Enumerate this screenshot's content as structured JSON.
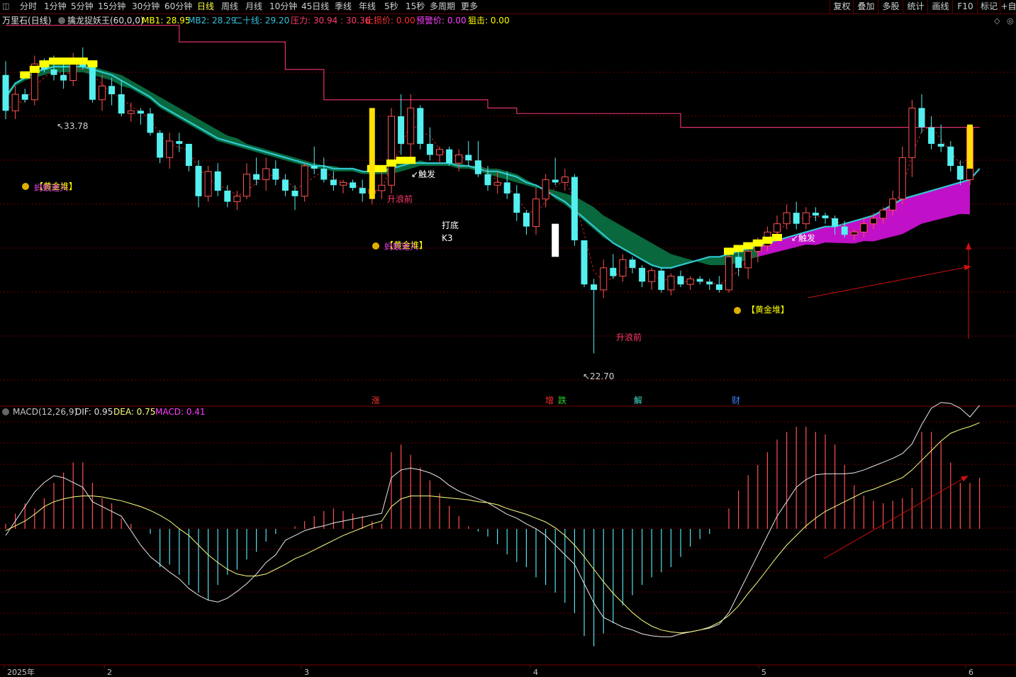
{
  "toolbar": {
    "left_items": [
      "分时",
      "1分钟",
      "5分钟",
      "15分钟",
      "30分钟",
      "60分钟",
      "日线",
      "周线",
      "月线",
      "10分钟",
      "45日线",
      "季线",
      "年线",
      "5秒",
      "15秒",
      "多周期",
      "更多"
    ],
    "active": "日线",
    "right_items": [
      "复权",
      "叠加",
      "多股",
      "统计",
      "画线",
      "F10",
      "标记",
      "+自"
    ]
  },
  "main_legend": {
    "stock": "万里石(日线)",
    "indicator": "擒龙捉妖王(60,0,0)",
    "items": [
      {
        "label": "MB1: 28.95",
        "color": "#ffff00"
      },
      {
        "label": "MB2: 28.29",
        "color": "#36c0d8"
      },
      {
        "label": "二十线: 29.20",
        "color": "#36c0d8"
      },
      {
        "label": "压力: 30.94",
        "color": "#ff3a6a"
      },
      {
        "label": ": 30.36",
        "color": "#ff3a6a"
      },
      {
        "label": "止损价: 0.00",
        "color": "#ff3030"
      },
      {
        "label": "预警价: 0.00",
        "color": "#ff40ff"
      },
      {
        "label": "狙击: 0.00",
        "color": "#ffff00"
      }
    ]
  },
  "macd_legend": {
    "items": [
      {
        "label": "MACD(12,26,9)",
        "color": "#c8c8c8"
      },
      {
        "label": "DIF: 0.95",
        "color": "#e0e0e0"
      },
      {
        "label": "DEA: 0.75",
        "color": "#ffff80"
      },
      {
        "label": "MACD: 0.41",
        "color": "#ff40ff"
      }
    ]
  },
  "annotations": {
    "high_label": "33.78",
    "low_label": "22.70",
    "gold_label": "【黄金堆】",
    "ant_label": "蚂蚁进入",
    "trigger_label": "触发",
    "wave_before": "升浪前",
    "bottom_label": "打底",
    "k3_label": "K3",
    "events": [
      {
        "text": "涨",
        "color": "#ff3030"
      },
      {
        "text": "增",
        "color": "#ff3030"
      },
      {
        "text": "跌",
        "color": "#30d030"
      },
      {
        "text": "解",
        "color": "#40e0d0"
      },
      {
        "text": "财",
        "color": "#4080ff"
      }
    ],
    "date_labels": [
      "2025年",
      "2",
      "3",
      "4",
      "5",
      "6"
    ]
  },
  "chart_data": {
    "type": "candlestick",
    "title": "万里石(日线)",
    "ylim": [
      21.5,
      34.8
    ],
    "ohlc": [
      [
        32.8,
        33.3,
        31.2,
        31.5
      ],
      [
        31.5,
        32.4,
        31.2,
        32.1
      ],
      [
        32.1,
        32.3,
        31.8,
        31.9
      ],
      [
        31.9,
        33.5,
        31.7,
        33.2
      ],
      [
        33.2,
        33.4,
        32.9,
        33.0
      ],
      [
        33.0,
        33.5,
        32.6,
        32.8
      ],
      [
        32.8,
        33.3,
        32.3,
        32.6
      ],
      [
        32.6,
        33.6,
        32.4,
        33.4
      ],
      [
        33.4,
        33.8,
        33.0,
        33.1
      ],
      [
        33.1,
        33.3,
        31.8,
        31.9
      ],
      [
        31.9,
        32.8,
        31.5,
        32.4
      ],
      [
        32.4,
        32.7,
        31.7,
        32.1
      ],
      [
        32.1,
        32.6,
        31.3,
        31.4
      ],
      [
        31.4,
        31.8,
        31.1,
        31.5
      ],
      [
        31.5,
        31.6,
        31.0,
        31.4
      ],
      [
        31.4,
        31.6,
        30.6,
        30.7
      ],
      [
        30.7,
        30.8,
        29.6,
        29.8
      ],
      [
        29.8,
        30.7,
        29.4,
        30.4
      ],
      [
        30.4,
        30.7,
        30.0,
        30.3
      ],
      [
        30.3,
        30.3,
        29.3,
        29.5
      ],
      [
        29.5,
        29.7,
        28.0,
        28.4
      ],
      [
        28.4,
        29.5,
        28.2,
        29.3
      ],
      [
        29.3,
        29.6,
        28.4,
        28.6
      ],
      [
        28.6,
        28.8,
        28.0,
        28.2
      ],
      [
        28.2,
        28.6,
        27.9,
        28.4
      ],
      [
        28.4,
        29.6,
        28.3,
        29.2
      ],
      [
        29.2,
        29.8,
        28.8,
        29.0
      ],
      [
        29.0,
        29.8,
        28.6,
        29.4
      ],
      [
        29.4,
        29.7,
        28.8,
        29.0
      ],
      [
        29.0,
        29.2,
        28.4,
        28.6
      ],
      [
        28.6,
        28.8,
        27.9,
        28.4
      ],
      [
        28.4,
        29.6,
        28.2,
        29.5
      ],
      [
        29.5,
        30.2,
        29.2,
        29.4
      ],
      [
        29.4,
        29.8,
        28.9,
        29.0
      ],
      [
        29.0,
        29.3,
        28.6,
        28.8
      ],
      [
        28.8,
        29.0,
        28.5,
        28.9
      ],
      [
        28.9,
        29.0,
        28.6,
        28.7
      ],
      [
        28.7,
        29.0,
        28.2,
        28.5
      ],
      [
        28.5,
        28.8,
        28.1,
        28.6
      ],
      [
        28.6,
        29.4,
        28.3,
        28.8
      ],
      [
        28.8,
        31.6,
        28.5,
        31.3
      ],
      [
        31.3,
        32.1,
        29.9,
        30.3
      ],
      [
        30.3,
        32.1,
        29.8,
        31.6
      ],
      [
        31.6,
        31.7,
        30.1,
        30.3
      ],
      [
        30.3,
        30.9,
        29.7,
        29.9
      ],
      [
        29.9,
        30.2,
        29.6,
        30.1
      ],
      [
        30.1,
        30.2,
        29.5,
        29.6
      ],
      [
        29.6,
        30.1,
        29.3,
        29.9
      ],
      [
        29.9,
        30.4,
        29.5,
        29.7
      ],
      [
        29.7,
        30.4,
        29.1,
        29.2
      ],
      [
        29.2,
        29.5,
        28.6,
        28.8
      ],
      [
        28.8,
        29.3,
        28.5,
        28.9
      ],
      [
        28.9,
        29.3,
        28.3,
        28.5
      ],
      [
        28.5,
        28.8,
        27.5,
        27.8
      ],
      [
        27.8,
        27.9,
        27.0,
        27.3
      ],
      [
        27.3,
        28.7,
        27.0,
        28.3
      ],
      [
        28.3,
        29.2,
        28.0,
        29.0
      ],
      [
        29.0,
        29.8,
        28.8,
        28.9
      ],
      [
        28.9,
        29.4,
        28.6,
        29.1
      ],
      [
        29.1,
        29.2,
        26.6,
        26.8
      ],
      [
        26.8,
        26.8,
        25.1,
        25.2
      ],
      [
        25.2,
        25.4,
        22.7,
        25.0
      ],
      [
        25.0,
        26.1,
        24.7,
        25.8
      ],
      [
        25.8,
        26.3,
        25.4,
        25.5
      ],
      [
        25.5,
        26.3,
        25.3,
        26.1
      ],
      [
        26.1,
        26.2,
        25.6,
        25.8
      ],
      [
        25.8,
        25.9,
        25.1,
        25.3
      ],
      [
        25.3,
        25.8,
        25.0,
        25.7
      ],
      [
        25.7,
        25.8,
        24.9,
        25.0
      ],
      [
        25.0,
        25.6,
        24.8,
        25.5
      ],
      [
        25.5,
        25.7,
        25.1,
        25.2
      ],
      [
        25.2,
        25.5,
        25.0,
        25.4
      ],
      [
        25.4,
        25.5,
        25.2,
        25.3
      ],
      [
        25.3,
        25.4,
        25.0,
        25.2
      ],
      [
        25.2,
        25.5,
        24.9,
        25.0
      ],
      [
        25.0,
        26.4,
        24.9,
        26.2
      ],
      [
        26.2,
        26.4,
        25.5,
        25.8
      ],
      [
        25.8,
        26.6,
        25.4,
        26.4
      ],
      [
        26.4,
        26.9,
        26.0,
        26.6
      ],
      [
        26.6,
        27.3,
        26.4,
        27.1
      ],
      [
        27.1,
        27.7,
        26.8,
        27.4
      ],
      [
        27.4,
        28.1,
        27.2,
        27.8
      ],
      [
        27.8,
        28.2,
        27.2,
        27.4
      ],
      [
        27.4,
        28.0,
        27.2,
        27.8
      ],
      [
        27.8,
        28.0,
        27.5,
        27.7
      ],
      [
        27.7,
        27.8,
        27.4,
        27.6
      ],
      [
        27.6,
        27.7,
        27.0,
        27.3
      ],
      [
        27.3,
        27.5,
        26.9,
        27.0
      ],
      [
        27.0,
        27.2,
        26.8,
        27.1
      ],
      [
        27.1,
        27.6,
        26.9,
        27.4
      ],
      [
        27.4,
        27.8,
        27.2,
        27.6
      ],
      [
        27.6,
        28.0,
        27.4,
        27.9
      ],
      [
        27.9,
        28.6,
        27.7,
        28.3
      ],
      [
        28.3,
        30.2,
        28.1,
        29.8
      ],
      [
        29.8,
        31.9,
        29.1,
        31.6
      ],
      [
        31.6,
        32.1,
        30.7,
        30.9
      ],
      [
        30.9,
        31.3,
        30.1,
        30.3
      ],
      [
        30.3,
        31.0,
        30.0,
        30.2
      ],
      [
        30.2,
        30.4,
        29.3,
        29.5
      ],
      [
        29.5,
        29.7,
        28.8,
        29.0
      ],
      [
        29.0,
        31.0,
        28.8,
        30.9
      ]
    ],
    "ma_slow": [
      31.9,
      32.4,
      32.6,
      32.7,
      32.8,
      32.9,
      32.9,
      32.9,
      32.9,
      32.8,
      32.7,
      32.6,
      32.4,
      32.3,
      32.1,
      31.9,
      31.6,
      31.4,
      31.2,
      31.0,
      30.8,
      30.6,
      30.4,
      30.3,
      30.2,
      30.1,
      30.0,
      29.9,
      29.8,
      29.7,
      29.6,
      29.5,
      29.4,
      29.4,
      29.3,
      29.3,
      29.3,
      29.2,
      29.2,
      29.2,
      29.2,
      29.3,
      29.4,
      29.5,
      29.5,
      29.5,
      29.5,
      29.4,
      29.4,
      29.3,
      29.2,
      29.1,
      29.0,
      28.9,
      28.8,
      28.7,
      28.7,
      28.6,
      28.5,
      28.4,
      28.2,
      28.0,
      27.7,
      27.5,
      27.3,
      27.1,
      26.9,
      26.7,
      26.5,
      26.3,
      26.2,
      26.1,
      26.0,
      25.9,
      25.9,
      25.9,
      26.0,
      26.1,
      26.2,
      26.3,
      26.4,
      26.5,
      26.6,
      26.7,
      26.7,
      26.8,
      26.8,
      26.8,
      26.8,
      26.9,
      26.9,
      27.0,
      27.1,
      27.2,
      27.4,
      27.6,
      27.7,
      27.8,
      27.9,
      28.0,
      28.0,
      28.3
    ],
    "ma_fast": [
      32.0,
      32.5,
      32.7,
      32.9,
      33.1,
      33.2,
      33.2,
      33.2,
      33.2,
      33.1,
      33.0,
      32.9,
      32.8,
      32.6,
      32.4,
      32.2,
      32.0,
      31.8,
      31.6,
      31.4,
      31.2,
      31.0,
      30.8,
      30.6,
      30.5,
      30.3,
      30.2,
      30.1,
      30.0,
      29.9,
      29.8,
      29.7,
      29.6,
      29.5,
      29.5,
      29.4,
      29.4,
      29.3,
      29.3,
      29.3,
      29.5,
      29.6,
      29.6,
      29.7,
      29.6,
      29.6,
      29.6,
      29.6,
      29.5,
      29.5,
      29.4,
      29.4,
      29.3,
      29.2,
      29.0,
      28.8,
      28.6,
      28.3,
      28.1,
      27.8,
      27.5,
      27.2,
      26.9,
      26.7,
      26.5,
      26.3,
      26.1,
      25.9,
      25.8,
      25.8,
      25.9,
      26.0,
      26.1,
      26.2,
      26.2,
      26.3,
      26.4,
      26.5,
      26.6,
      26.7,
      26.8,
      26.9,
      27.0,
      27.1,
      27.2,
      27.3,
      27.3,
      27.4,
      27.5,
      27.6,
      27.7,
      27.9,
      28.1,
      28.3,
      28.4,
      28.5,
      28.6,
      28.7,
      28.8,
      28.9,
      29.0,
      29.6
    ],
    "ma_mid": [
      32.0,
      32.5,
      32.7,
      32.9,
      33.0,
      33.1,
      33.1,
      33.1,
      33.1,
      33.0,
      32.9,
      32.8,
      32.6,
      32.4,
      32.2,
      32.0,
      31.7,
      31.5,
      31.3,
      31.1,
      30.9,
      30.7,
      30.5,
      30.4,
      30.3,
      30.2,
      30.1,
      30.0,
      29.9,
      29.8,
      29.7,
      29.6,
      29.5,
      29.5,
      29.4,
      29.4,
      29.4,
      29.3,
      29.3,
      29.3,
      29.4,
      29.5,
      29.6,
      29.6,
      29.6,
      29.6,
      29.6,
      29.5,
      29.5,
      29.4,
      29.3,
      29.3,
      29.2,
      29.1,
      28.9,
      28.8,
      28.6,
      28.4,
      28.2,
      27.9,
      27.6,
      27.3,
      27.0,
      26.7,
      26.5,
      26.3,
      26.1,
      25.9,
      25.8,
      25.8,
      25.9,
      26.0,
      26.1,
      26.2,
      26.2,
      26.3,
      26.4,
      26.5,
      26.6,
      26.7,
      26.8,
      26.9,
      27.0,
      27.1,
      27.2,
      27.3,
      27.3,
      27.4,
      27.5,
      27.6,
      27.7,
      27.9,
      28.1,
      28.3,
      28.4,
      28.5,
      28.6,
      28.7,
      28.8,
      28.9,
      29.0,
      29.4
    ],
    "pressure": [
      {
        "from": 0,
        "to": 18,
        "value": 34.6
      },
      {
        "from": 18,
        "to": 29,
        "value": 34.0
      },
      {
        "from": 29,
        "to": 33,
        "value": 33.0
      },
      {
        "from": 33,
        "to": 50,
        "value": 31.9
      },
      {
        "from": 50,
        "to": 53,
        "value": 31.6
      },
      {
        "from": 53,
        "to": 70,
        "value": 31.4
      },
      {
        "from": 70,
        "to": 101,
        "value": 30.9
      }
    ],
    "macd": {
      "hist": [
        0.02,
        0.06,
        0.1,
        0.08,
        0.12,
        0.18,
        0.22,
        0.26,
        0.26,
        0.18,
        0.12,
        0.1,
        0.04,
        0.02,
        0.0,
        -0.02,
        -0.15,
        -0.14,
        -0.18,
        -0.22,
        -0.25,
        -0.28,
        -0.22,
        -0.18,
        -0.16,
        -0.12,
        -0.09,
        -0.05,
        -0.02,
        0.0,
        0.01,
        0.03,
        0.05,
        0.07,
        0.08,
        0.07,
        0.06,
        0.05,
        0.03,
        0.02,
        0.3,
        0.33,
        0.29,
        0.24,
        0.19,
        0.14,
        0.09,
        0.05,
        0.01,
        -0.01,
        -0.03,
        -0.06,
        -0.1,
        -0.13,
        -0.15,
        -0.19,
        -0.22,
        -0.25,
        -0.29,
        -0.33,
        -0.42,
        -0.46,
        -0.41,
        -0.37,
        -0.3,
        -0.26,
        -0.22,
        -0.19,
        -0.17,
        -0.15,
        -0.11,
        -0.07,
        -0.04,
        -0.02,
        0.0,
        0.08,
        0.15,
        0.21,
        0.25,
        0.3,
        0.35,
        0.38,
        0.4,
        0.4,
        0.38,
        0.37,
        0.33,
        0.25,
        0.17,
        0.13,
        0.11,
        0.1,
        0.11,
        0.12,
        0.16,
        0.38,
        0.38,
        0.34,
        0.26,
        0.18,
        0.18,
        0.2
      ],
      "dif": [
        -0.4,
        -0.25,
        -0.1,
        0.05,
        0.15,
        0.22,
        0.2,
        0.15,
        0.1,
        -0.05,
        -0.1,
        -0.15,
        -0.2,
        -0.35,
        -0.5,
        -0.62,
        -0.7,
        -0.78,
        -0.85,
        -0.95,
        -1.02,
        -1.07,
        -1.09,
        -1.05,
        -0.98,
        -0.9,
        -0.8,
        -0.68,
        -0.6,
        -0.45,
        -0.4,
        -0.35,
        -0.32,
        -0.3,
        -0.27,
        -0.25,
        -0.23,
        -0.21,
        -0.19,
        -0.17,
        0.2,
        0.28,
        0.3,
        0.28,
        0.25,
        0.2,
        0.12,
        0.06,
        0.02,
        -0.02,
        -0.06,
        -0.12,
        -0.18,
        -0.22,
        -0.28,
        -0.33,
        -0.4,
        -0.5,
        -0.6,
        -0.7,
        -0.9,
        -1.1,
        -1.25,
        -1.3,
        -1.35,
        -1.38,
        -1.42,
        -1.44,
        -1.45,
        -1.45,
        -1.42,
        -1.4,
        -1.38,
        -1.36,
        -1.32,
        -1.2,
        -1.0,
        -0.8,
        -0.6,
        -0.4,
        -0.2,
        -0.05,
        0.1,
        0.18,
        0.23,
        0.24,
        0.24,
        0.24,
        0.25,
        0.28,
        0.32,
        0.36,
        0.4,
        0.45,
        0.55,
        0.75,
        0.92,
        0.98,
        0.97,
        0.92,
        0.83,
        0.95
      ],
      "dea": [
        -0.35,
        -0.3,
        -0.25,
        -0.18,
        -0.1,
        -0.05,
        -0.02,
        0.0,
        0.01,
        0.01,
        0.0,
        -0.02,
        -0.04,
        -0.07,
        -0.1,
        -0.14,
        -0.19,
        -0.25,
        -0.33,
        -0.4,
        -0.5,
        -0.6,
        -0.68,
        -0.75,
        -0.8,
        -0.82,
        -0.82,
        -0.8,
        -0.75,
        -0.7,
        -0.64,
        -0.6,
        -0.55,
        -0.5,
        -0.45,
        -0.4,
        -0.36,
        -0.32,
        -0.28,
        -0.25,
        -0.1,
        -0.02,
        0.01,
        0.01,
        0.01,
        0.0,
        -0.01,
        -0.02,
        -0.03,
        -0.05,
        -0.06,
        -0.08,
        -0.12,
        -0.15,
        -0.18,
        -0.22,
        -0.26,
        -0.32,
        -0.4,
        -0.5,
        -0.62,
        -0.75,
        -0.88,
        -1.0,
        -1.1,
        -1.2,
        -1.28,
        -1.34,
        -1.38,
        -1.4,
        -1.41,
        -1.4,
        -1.38,
        -1.35,
        -1.3,
        -1.23,
        -1.13,
        -1.0,
        -0.88,
        -0.75,
        -0.62,
        -0.5,
        -0.4,
        -0.3,
        -0.22,
        -0.15,
        -0.1,
        -0.05,
        0.0,
        0.05,
        0.08,
        0.12,
        0.16,
        0.2,
        0.28,
        0.38,
        0.48,
        0.58,
        0.66,
        0.7,
        0.73,
        0.77
      ]
    }
  }
}
